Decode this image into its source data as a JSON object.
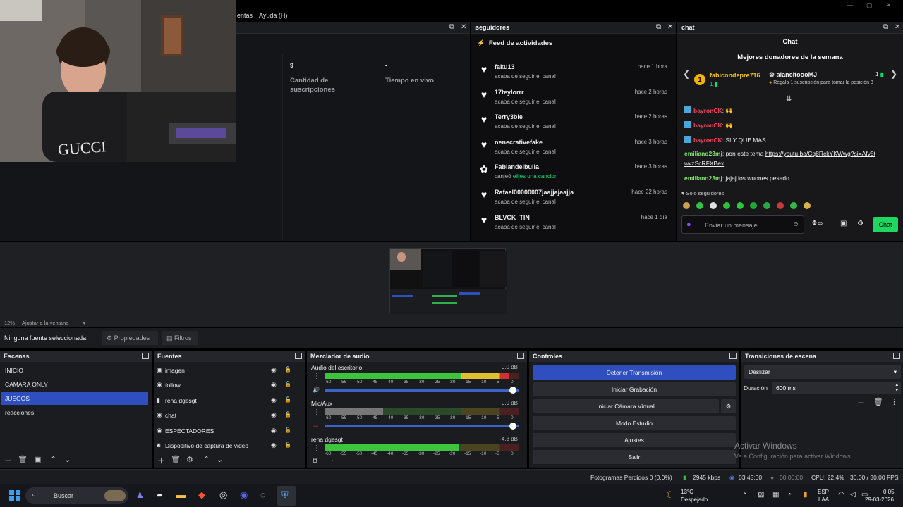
{
  "menubar": {
    "items": [
      "entas",
      "Ayuda (H)"
    ]
  },
  "docks": {
    "seguidores": {
      "title": "seguidores"
    },
    "chat": {
      "title": "chat"
    }
  },
  "stats": [
    {
      "value": "9",
      "label": "Cantidad de suscripciones"
    },
    {
      "value": "-",
      "label": "Tiempo en vivo"
    }
  ],
  "feed": {
    "title": "Feed de actividades",
    "items": [
      {
        "name": "faku13",
        "action": "acaba de seguir el canal",
        "time": "hace 1 hora",
        "icon": "heart-icon"
      },
      {
        "name": "17teylorrr",
        "action": "acaba de seguir el canal",
        "time": "hace 2 horas",
        "icon": "heart-icon"
      },
      {
        "name": "Terry3ble",
        "action": "acaba de seguir el canal",
        "time": "hace 2 horas",
        "icon": "heart-icon"
      },
      {
        "name": "nenecrativefake",
        "action": "acaba de seguir el canal",
        "time": "hace 3 horas",
        "icon": "heart-icon"
      },
      {
        "name": "Fabiandelbulla",
        "action": "canjeó",
        "action_highlight": "elijes una cancion",
        "time": "hace 3 horas",
        "icon": "points-icon"
      },
      {
        "name": "Rafael00000007jaajjajaajja",
        "action": "acaba de seguir el canal",
        "time": "hace 22 horas",
        "icon": "heart-icon"
      },
      {
        "name": "BLVCK_TIN",
        "action": "acaba de seguir el canal",
        "time": "hace 1 día",
        "icon": "heart-icon"
      }
    ]
  },
  "chat": {
    "header": "Chat",
    "donors_title": "Mejores donadores de la semana",
    "donor1": {
      "name": "fabicondepre716",
      "count": "1"
    },
    "donor2": {
      "name": "alancitoooMJ",
      "count": "1",
      "note": "Regala 1 suscripción para tomar la posición 3"
    },
    "messages": [
      {
        "user": "bayronCK",
        "text": ": 🙌"
      },
      {
        "user": "bayronCK",
        "text": ": 🙌"
      },
      {
        "user": "bayronCK",
        "text": ": SI Y QUE MAS"
      },
      {
        "user": "emiliano23mj",
        "text": ": pon este tema ",
        "link": "https://youtu.be/Cq8RckYKWwg?si=Afv5twvzScRFXBex"
      },
      {
        "user": "emiliano23mj",
        "text": ": jajaj los wuones pesado"
      }
    ],
    "followers_only": "Solo seguidores",
    "input_placeholder": "Enviar un mensaje",
    "send_label": "Chat",
    "points": "∞"
  },
  "preview": {
    "zoom": "12%",
    "fit_label": "Ajustar a la ventana"
  },
  "source_toolbar": {
    "selection": "Ninguna fuente seleccionada",
    "properties": "Propiedades",
    "filters": "Filtros"
  },
  "scenes": {
    "title": "Escenas",
    "items": [
      "INICIO",
      "CAMARA ONLY",
      "JUEGOS",
      "reacciones"
    ],
    "selected_index": 2
  },
  "sources": {
    "title": "Fuentes",
    "items": [
      {
        "label": "imagen",
        "icon": "image-icon"
      },
      {
        "label": "follow",
        "icon": "browser-icon"
      },
      {
        "label": "rena dgesgt",
        "icon": "mic-icon"
      },
      {
        "label": "chat",
        "icon": "browser-icon"
      },
      {
        "label": "ESPECTADORES",
        "icon": "browser-icon"
      },
      {
        "label": "Dispositivo de captura de video",
        "icon": "camera-icon"
      }
    ]
  },
  "mixer": {
    "title": "Mezclador de audio",
    "channels": [
      {
        "name": "Audio del escritorio",
        "db": "0.0 dB",
        "level": 0.95
      },
      {
        "name": "Mic/Aux",
        "db": "0.0 dB",
        "level": 0.3
      },
      {
        "name": "rena dgesgt",
        "db": "-4.8 dB",
        "level": 0.69
      }
    ],
    "scale": [
      "-60",
      "-55",
      "-50",
      "-45",
      "-40",
      "-35",
      "-30",
      "-25",
      "-20",
      "-15",
      "-10",
      "-5",
      "0"
    ]
  },
  "controls": {
    "title": "Controles",
    "buttons": [
      "Detener Transmisión",
      "Iniciar Grabación",
      "Iniciar Cámara Virtual",
      "Modo Estudio",
      "Ajustes",
      "Salir"
    ]
  },
  "transitions": {
    "title": "Transiciones de escena",
    "type": "Deslizar",
    "duration_label": "Duración",
    "duration_value": "600 ms"
  },
  "watermark": {
    "line1": "Activar Windows",
    "line2": "Ve a Configuración para activar Windows."
  },
  "statusbar": {
    "dropped": "Fotogramas Perdidos 0 (0.0%)",
    "bitrate": "2945 kbps",
    "stream_time": "03:45:00",
    "rec_time": "00:00:00",
    "cpu": "CPU: 22.4%",
    "fps": "30.00 / 30.00 FPS"
  },
  "taskbar": {
    "search": "Buscar",
    "weather_temp": "13°C",
    "weather_desc": "Despejado",
    "lang1": "ESP",
    "lang2": "LAA",
    "time": "0:05",
    "date": "29-03-2026"
  },
  "colors": {
    "accent": "#2f4ec0",
    "twitch_green": "#00e676",
    "chat_purple": "#9147ff"
  }
}
